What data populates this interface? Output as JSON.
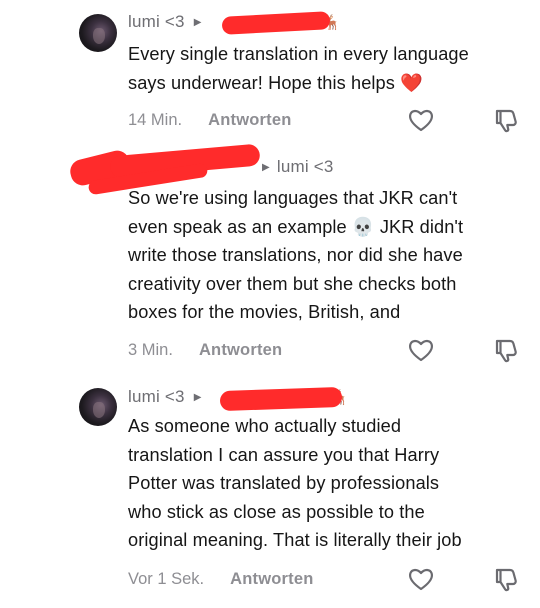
{
  "comments": [
    {
      "user": "lumi <3",
      "reply_to_icon": "deer-emoji",
      "text_lines": [
        "Every single translation in every language",
        "says underwear! Hope this helps ❤️"
      ],
      "time": "14 Min.",
      "reply_label": "Antworten"
    },
    {
      "reply_to": "lumi <3",
      "text_lines": [
        "So we're using languages that JKR can't",
        "even speak as an example 💀 JKR didn't",
        "write those translations, nor did she have",
        "creativity over them but she checks both",
        "boxes for the movies, British, and"
      ],
      "time": "3 Min.",
      "reply_label": "Antworten"
    },
    {
      "user": "lumi <3",
      "reply_to_icon": "deer-emoji",
      "text_lines": [
        "As someone who actually studied",
        "translation I can assure you that Harry",
        "Potter was translated by professionals",
        "who stick as close as possible to the",
        "original meaning. That is literally their job"
      ],
      "time": "Vor 1 Sek.",
      "reply_label": "Antworten"
    }
  ],
  "colors": {
    "redaction": "#ff2b2b",
    "meta": "#8e8e93",
    "text": "#161616"
  },
  "icons": [
    "heart-outline-icon",
    "thumbs-down-icon",
    "caret-right-icon"
  ]
}
